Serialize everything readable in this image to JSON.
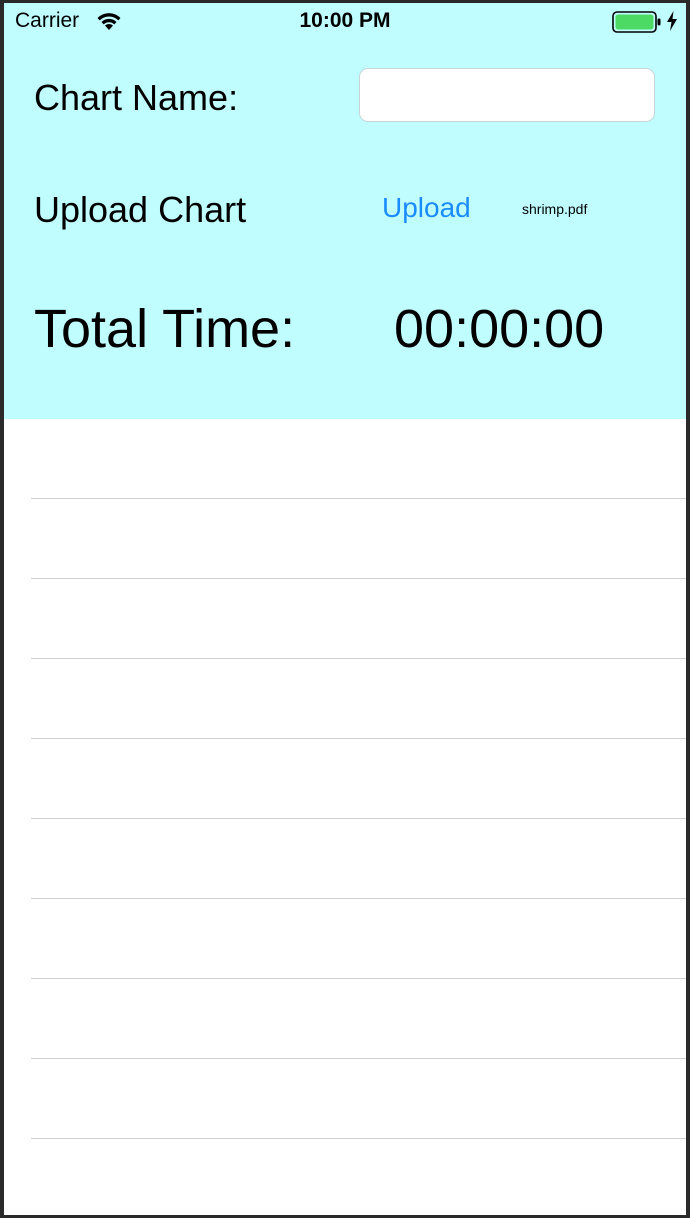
{
  "status_bar": {
    "carrier": "Carrier",
    "time": "10:00 PM",
    "battery_color": "#4cd964",
    "wifi_icon": "wifi-icon",
    "battery_icon": "battery-icon",
    "charging_icon": "bolt-icon"
  },
  "form": {
    "chart_name_label": "Chart Name:",
    "chart_name_value": "",
    "upload_label": "Upload Chart",
    "upload_button": "Upload",
    "file_name": "shrimp.pdf",
    "total_time_label": "Total Time:",
    "total_time_value": "00:00:00"
  },
  "colors": {
    "header_background": "#c0fdff",
    "link_blue": "#1a8cff",
    "separator": "#cfcfd2"
  },
  "table": {
    "rows": [
      "",
      "",
      "",
      "",
      "",
      "",
      "",
      "",
      ""
    ]
  }
}
